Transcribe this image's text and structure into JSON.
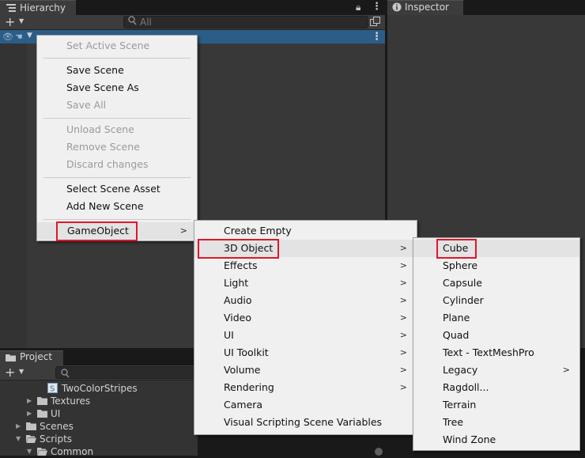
{
  "hierarchy": {
    "tab_label": "Hierarchy",
    "search_placeholder": "All"
  },
  "inspector": {
    "tab_label": "Inspector"
  },
  "project": {
    "tab_label": "Project",
    "tree": [
      {
        "label": "TwoColorStripes",
        "kind": "shader"
      },
      {
        "label": "Textures",
        "kind": "folder"
      },
      {
        "label": "UI",
        "kind": "folder"
      },
      {
        "label": "Scenes",
        "kind": "folder"
      },
      {
        "label": "Scripts",
        "kind": "folder"
      },
      {
        "label": "Common",
        "kind": "folder"
      }
    ]
  },
  "scene_menu": {
    "items": [
      {
        "label": "Set Active Scene",
        "enabled": false
      },
      {
        "label": "Save Scene",
        "enabled": true
      },
      {
        "label": "Save Scene As",
        "enabled": true
      },
      {
        "label": "Save All",
        "enabled": false
      },
      {
        "label": "Unload Scene",
        "enabled": false
      },
      {
        "label": "Remove Scene",
        "enabled": false
      },
      {
        "label": "Discard changes",
        "enabled": false
      },
      {
        "label": "Select Scene Asset",
        "enabled": true
      },
      {
        "label": "Add New Scene",
        "enabled": true
      },
      {
        "label": "GameObject",
        "enabled": true,
        "submenu": true,
        "highlighted": true
      }
    ]
  },
  "gameobject_menu": {
    "items": [
      {
        "label": "Create Empty"
      },
      {
        "label": "3D Object",
        "submenu": true,
        "highlighted": true
      },
      {
        "label": "Effects",
        "submenu": true
      },
      {
        "label": "Light",
        "submenu": true
      },
      {
        "label": "Audio",
        "submenu": true
      },
      {
        "label": "Video",
        "submenu": true
      },
      {
        "label": "UI",
        "submenu": true
      },
      {
        "label": "UI Toolkit",
        "submenu": true
      },
      {
        "label": "Volume",
        "submenu": true
      },
      {
        "label": "Rendering",
        "submenu": true
      },
      {
        "label": "Camera"
      },
      {
        "label": "Visual Scripting Scene Variables"
      }
    ]
  },
  "object3d_menu": {
    "items": [
      {
        "label": "Cube",
        "highlighted": true
      },
      {
        "label": "Sphere"
      },
      {
        "label": "Capsule"
      },
      {
        "label": "Cylinder"
      },
      {
        "label": "Plane"
      },
      {
        "label": "Quad"
      },
      {
        "label": "Text - TextMeshPro"
      },
      {
        "label": "Legacy",
        "submenu": true
      },
      {
        "label": "Ragdoll..."
      },
      {
        "label": "Terrain"
      },
      {
        "label": "Tree"
      },
      {
        "label": "Wind Zone"
      }
    ]
  },
  "colors": {
    "highlight_box": "#e0162b",
    "selected_row": "#2c5d87",
    "menu_background": "#f0f0f0"
  }
}
